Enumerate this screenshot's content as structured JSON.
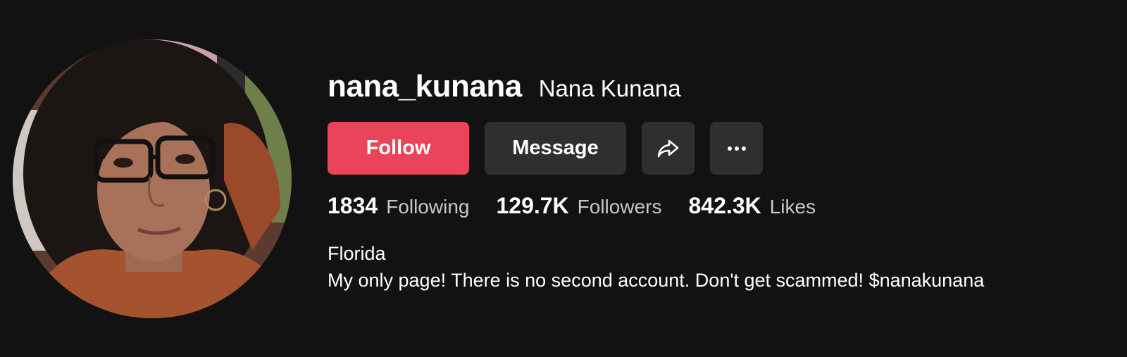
{
  "profile": {
    "username": "nana_kunana",
    "nickname": "Nana Kunana"
  },
  "actions": {
    "follow_label": "Follow",
    "message_label": "Message",
    "share_icon": "share-arrow-icon",
    "more_icon": "more-horizontal-icon",
    "follow_color": "#ea445a"
  },
  "stats": [
    {
      "value": "1834",
      "label": "Following"
    },
    {
      "value": "129.7K",
      "label": "Followers"
    },
    {
      "value": "842.3K",
      "label": "Likes"
    }
  ],
  "bio": {
    "location": "Florida",
    "text": "My only page! There is no second account. Don't get scammed! $nanakunana"
  }
}
